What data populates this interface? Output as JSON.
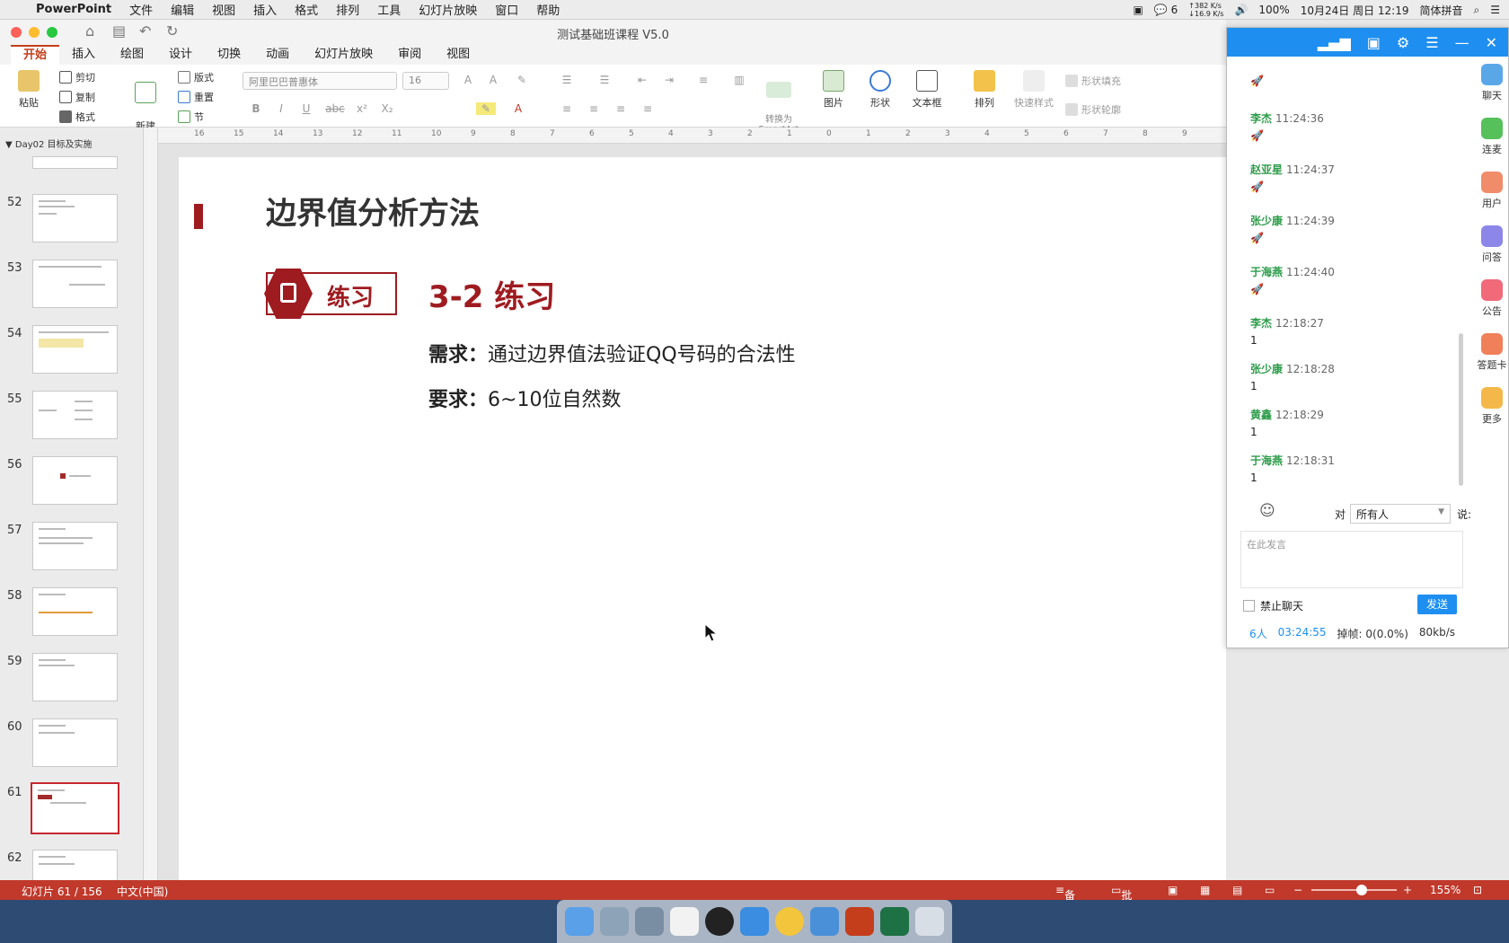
{
  "menubar": {
    "app_name": "PowerPoint",
    "items": [
      "文件",
      "编辑",
      "视图",
      "插入",
      "格式",
      "排列",
      "工具",
      "幻灯片放映",
      "窗口",
      "帮助"
    ],
    "chat_count": "6",
    "net_up": "382 K/s",
    "net_down": "16.9 K/s",
    "battery": "100%",
    "datetime": "10月24日 周日 12:19",
    "input_method": "简体拼音"
  },
  "window": {
    "title": "测试基础班课程 V5.0"
  },
  "ribbon": {
    "tabs": [
      "开始",
      "插入",
      "绘图",
      "设计",
      "切换",
      "动画",
      "幻灯片放映",
      "审阅",
      "视图"
    ],
    "paste": "粘贴",
    "cut": "剪切",
    "copy": "复制",
    "format": "格式",
    "new_slide": "新建\n幻灯片",
    "layout": "版式",
    "reset": "重置",
    "section": "节",
    "font_name": "阿里巴巴普惠体",
    "font_size": "16",
    "convert_smartart": "转换为\nSmartArt",
    "picture": "图片",
    "shape": "形状",
    "textbox": "文本框",
    "arrange": "排列",
    "quick_styles": "快速样式",
    "shape_fill": "形状填充",
    "shape_outline": "形状轮廓"
  },
  "thumbs": {
    "section_name": "Day02 目标及实施",
    "numbers": [
      "52",
      "53",
      "54",
      "55",
      "56",
      "57",
      "58",
      "59",
      "60",
      "61",
      "62"
    ]
  },
  "hruler_labels": [
    "16",
    "15",
    "14",
    "13",
    "12",
    "11",
    "10",
    "9",
    "8",
    "7",
    "6",
    "5",
    "4",
    "3",
    "2",
    "1",
    "0",
    "1",
    "2",
    "3",
    "4",
    "5",
    "6",
    "7",
    "8",
    "9"
  ],
  "slide": {
    "title": "边界值分析方法",
    "badge_label": "练习",
    "exercise_title": "3-2 练习",
    "req1_label": "需求：",
    "req1_text": "通过边界值法验证QQ号码的合法性",
    "req2_label": "要求：",
    "req2_text": "6~10位自然数"
  },
  "statusbar": {
    "slide_info": "幻灯片 61 / 156",
    "language": "中文(中国)",
    "notes": "备注",
    "comments": "批注",
    "zoom": "155%"
  },
  "chat": {
    "messages": [
      {
        "name": "",
        "time": "",
        "text": "🚀"
      },
      {
        "name": "李杰",
        "time": "11:24:36",
        "text": "🚀"
      },
      {
        "name": "赵亚星",
        "time": "11:24:37",
        "text": "🚀"
      },
      {
        "name": "张少康",
        "time": "11:24:39",
        "text": "🚀"
      },
      {
        "name": "于海燕",
        "time": "11:24:40",
        "text": "🚀"
      },
      {
        "name": "李杰",
        "time": "12:18:27",
        "text": "1"
      },
      {
        "name": "张少康",
        "time": "12:18:28",
        "text": "1"
      },
      {
        "name": "黄鑫",
        "time": "12:18:29",
        "text": "1"
      },
      {
        "name": "于海燕",
        "time": "12:18:31",
        "text": "1"
      }
    ],
    "side_items": [
      "聊天",
      "连麦",
      "用户",
      "问答",
      "公告",
      "答题卡",
      "更多"
    ],
    "to_label": "对",
    "to_value": "所有人",
    "say_label": "说:",
    "input_placeholder": "在此发言",
    "mute_label": "禁止聊天",
    "send_label": "发送",
    "people": "6人",
    "duration": "03:24:55",
    "dropped_frames": "掉帧: 0(0.0%)",
    "bitrate": "80kb/s"
  },
  "colors": {
    "accent_red": "#9e1b20",
    "status_red": "#c0392b",
    "chat_blue": "#1e8ff0",
    "chat_name_green": "#2d9c4a"
  }
}
